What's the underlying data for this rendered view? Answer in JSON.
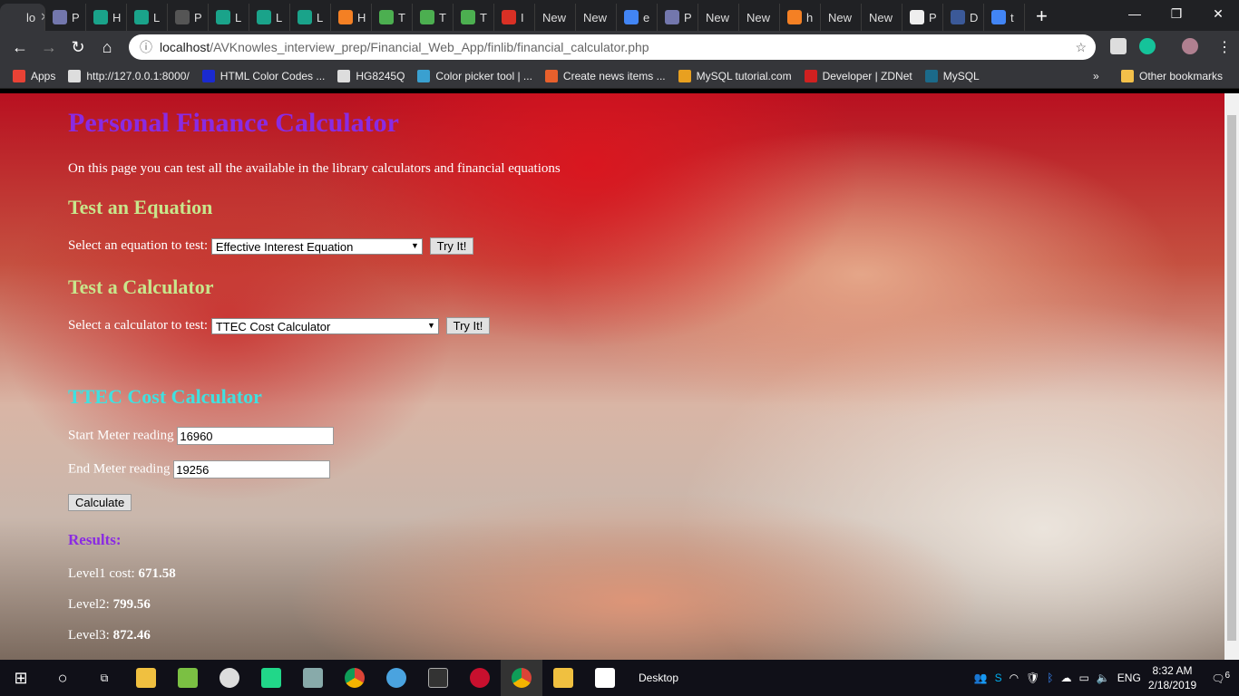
{
  "browser": {
    "tabs": [
      {
        "label": "lo",
        "icon": "page-icon",
        "color": "#35363a",
        "active": true
      },
      {
        "label": "P",
        "icon": "php-icon",
        "color": "#7377ad"
      },
      {
        "label": "H",
        "icon": "hex-icon",
        "color": "#1aa38a"
      },
      {
        "label": "L",
        "icon": "hex-icon",
        "color": "#1aa38a"
      },
      {
        "label": "P",
        "icon": "page-icon",
        "color": "#555"
      },
      {
        "label": "L",
        "icon": "hex-icon",
        "color": "#1aa38a"
      },
      {
        "label": "L",
        "icon": "hex-icon",
        "color": "#1aa38a"
      },
      {
        "label": "L",
        "icon": "hex-icon",
        "color": "#1aa38a"
      },
      {
        "label": "H",
        "icon": "stackoverflow-icon",
        "color": "#f48024"
      },
      {
        "label": "T",
        "icon": "w3schools-icon",
        "color": "#4caf50"
      },
      {
        "label": "T",
        "icon": "w3schools-icon",
        "color": "#4caf50"
      },
      {
        "label": "T",
        "icon": "w3schools-icon",
        "color": "#4caf50"
      },
      {
        "label": "I",
        "icon": "gmail-icon",
        "color": "#d93025"
      },
      {
        "label": "New",
        "icon": "",
        "color": ""
      },
      {
        "label": "New",
        "icon": "",
        "color": ""
      },
      {
        "label": "e",
        "icon": "google-icon",
        "color": "#4285f4"
      },
      {
        "label": "P",
        "icon": "php-icon",
        "color": "#7377ad"
      },
      {
        "label": "New",
        "icon": "",
        "color": ""
      },
      {
        "label": "New",
        "icon": "",
        "color": ""
      },
      {
        "label": "h",
        "icon": "stackoverflow-icon",
        "color": "#f48024"
      },
      {
        "label": "New",
        "icon": "",
        "color": ""
      },
      {
        "label": "New",
        "icon": "",
        "color": ""
      },
      {
        "label": "P",
        "icon": "wikipedia-icon",
        "color": "#eee"
      },
      {
        "label": "D",
        "icon": "ad-icon",
        "color": "#3b5998"
      },
      {
        "label": "t",
        "icon": "google-icon",
        "color": "#4285f4"
      }
    ],
    "url_host": "localhost",
    "url_path": "/AVKnowles_interview_prep/Financial_Web_App/finlib/financial_calculator.php",
    "bookmarks": [
      {
        "label": "Apps",
        "color": "#e94235"
      },
      {
        "label": "http://127.0.0.1:8000/",
        "color": "#ddd"
      },
      {
        "label": "HTML Color Codes ...",
        "color": "#1a2ad0"
      },
      {
        "label": "HG8245Q",
        "color": "#ddd"
      },
      {
        "label": "Color picker tool | ...",
        "color": "#3aa0d0"
      },
      {
        "label": "Create news items ...",
        "color": "#e8602c"
      },
      {
        "label": "MySQL tutorial.com",
        "color": "#e8a020"
      },
      {
        "label": "Developer | ZDNet",
        "color": "#d02020"
      },
      {
        "label": "MySQL",
        "color": "#1b6a8a"
      }
    ],
    "more_bookmarks": "»",
    "other_bookmarks": "Other bookmarks"
  },
  "page": {
    "title": "Personal Finance Calculator",
    "intro": "On this page you can test all the available in the library calculators and financial equations",
    "equation_heading": "Test an Equation",
    "equation_label": "Select an equation to test:",
    "equation_selected": "Effective Interest Equation",
    "equation_button": "Try It!",
    "calculator_heading": "Test a Calculator",
    "calculator_label": "Select a calculator to test:",
    "calculator_selected": "TTEC Cost Calculator",
    "calculator_button": "Try It!",
    "calc_title": "TTEC Cost Calculator",
    "start_label": "Start Meter reading",
    "start_value": "16960",
    "end_label": "End Meter reading",
    "end_value": "19256",
    "calculate_button": "Calculate",
    "results_heading": "Results:",
    "results": [
      {
        "label": "Level1 cost: ",
        "value": "671.58"
      },
      {
        "label": "Level2: ",
        "value": "799.56"
      },
      {
        "label": "Level3: ",
        "value": "872.46"
      }
    ],
    "colors": {
      "title": "#8a2be2",
      "section": "#c8e68c",
      "calc_title": "#40e0e0",
      "results": "#8a2be2"
    }
  },
  "taskbar": {
    "desktop_label": "Desktop",
    "language": "ENG",
    "time": "8:32 AM",
    "date": "2/18/2019",
    "notifications": "6"
  }
}
